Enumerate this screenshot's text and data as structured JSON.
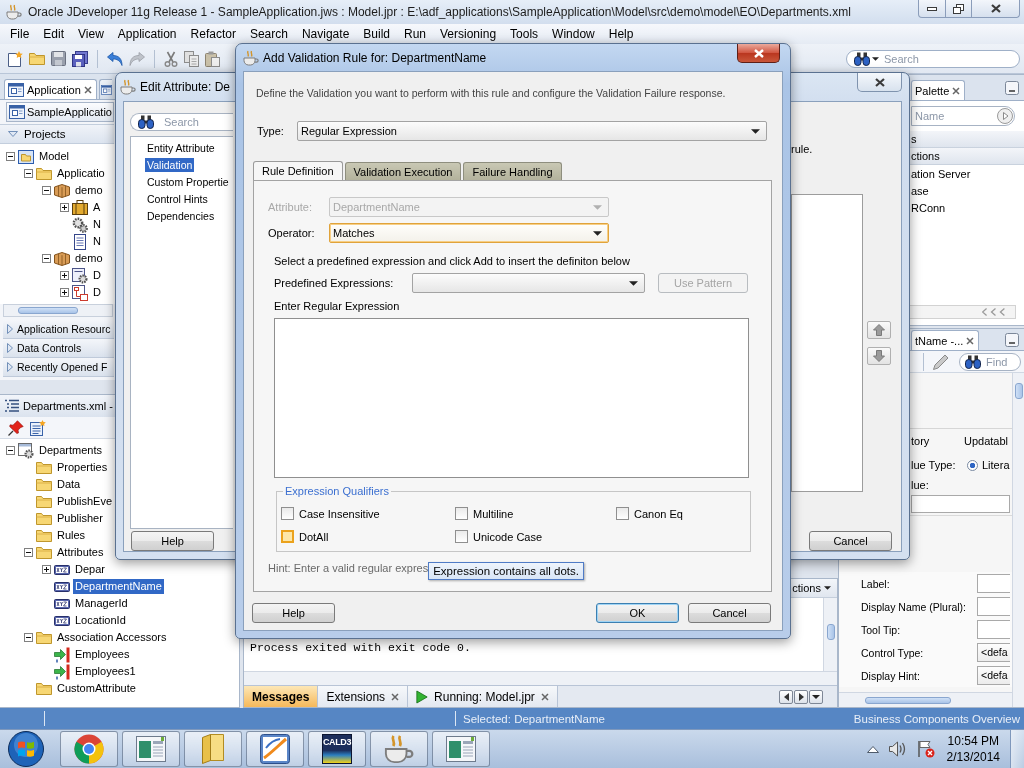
{
  "window": {
    "title": "Oracle JDeveloper 11g Release 1 - SampleApplication.jws : Model.jpr : E:\\adf_applications\\SampleApplication\\Model\\src\\demo\\model\\EO\\Departments.xml",
    "menu": [
      "File",
      "Edit",
      "View",
      "Application",
      "Refactor",
      "Search",
      "Navigate",
      "Build",
      "Run",
      "Versioning",
      "Tools",
      "Window",
      "Help"
    ],
    "search": {
      "placeholder": "Search"
    }
  },
  "navigator": {
    "tab": {
      "label": "Application",
      "selected": true
    },
    "project": "SampleApplicatio",
    "section": {
      "label": "Projects",
      "expanded": true
    },
    "tree": [
      {
        "label": "Model",
        "kind": "project",
        "expanded": true,
        "children": [
          {
            "label": "Applicatio",
            "kind": "folder",
            "expanded": true,
            "children": [
              {
                "label": "demo",
                "kind": "package",
                "expanded": true,
                "children": [
                  {
                    "label": "A",
                    "kind": "briefcase",
                    "expanded": false
                  },
                  {
                    "label": "N",
                    "kind": "gears"
                  },
                  {
                    "label": "N",
                    "kind": "document"
                  }
                ]
              },
              {
                "label": "demo",
                "kind": "package",
                "expanded": true,
                "children": [
                  {
                    "label": "D",
                    "kind": "gear-document",
                    "expanded": false
                  },
                  {
                    "label": "D",
                    "kind": "diagram",
                    "expanded": false
                  }
                ]
              }
            ]
          }
        ]
      }
    ],
    "accordions": [
      {
        "label": "Application Resourc",
        "expanded": false
      },
      {
        "label": "Data Controls",
        "expanded": false
      },
      {
        "label": "Recently Opened F",
        "expanded": false
      }
    ]
  },
  "structure": {
    "title": "Departments.xml -",
    "tree": [
      {
        "label": "Departments",
        "kind": "entity",
        "expanded": true,
        "selected": false,
        "children": [
          {
            "label": "Properties",
            "kind": "folder",
            "selected": false
          },
          {
            "label": "Data",
            "kind": "folder",
            "selected": false
          },
          {
            "label": "PublishEve",
            "kind": "folder",
            "selected": false
          },
          {
            "label": "Publisher",
            "kind": "folder",
            "selected": false
          },
          {
            "label": "Rules",
            "kind": "folder",
            "selected": false
          },
          {
            "label": "Attributes",
            "kind": "folder",
            "expanded": true,
            "selected": false,
            "children": [
              {
                "label": "Depar",
                "kind": "attribute",
                "expanded": false,
                "selected": false
              },
              {
                "label": "DepartmentName",
                "kind": "attribute",
                "selected": true
              },
              {
                "label": "ManagerId",
                "kind": "attribute",
                "selected": false
              },
              {
                "label": "LocationId",
                "kind": "attribute",
                "selected": false
              }
            ]
          },
          {
            "label": "Association Accessors",
            "kind": "folder",
            "expanded": true,
            "selected": false,
            "children": [
              {
                "label": "Employees",
                "kind": "association",
                "selected": false
              },
              {
                "label": "Employees1",
                "kind": "association",
                "selected": false
              }
            ]
          },
          {
            "label": "CustomAttribute",
            "kind": "folder",
            "selected": false
          }
        ]
      }
    ]
  },
  "edit_dialog": {
    "title": "Edit Attribute: De",
    "search": {
      "placeholder": "Search"
    },
    "nav": [
      {
        "label": "Entity Attribute",
        "selected": false
      },
      {
        "label": "Validation",
        "selected": true
      },
      {
        "label": "Custom Propertie",
        "selected": false
      },
      {
        "label": "Control Hints",
        "selected": false
      },
      {
        "label": "Dependencies",
        "selected": false
      }
    ],
    "note": "rule.",
    "buttons": [
      {
        "label": "Help"
      },
      {
        "label": "Cancel"
      }
    ]
  },
  "validation_dialog": {
    "title": "Add Validation Rule for: DepartmentName",
    "description": "Define the Validation you want to perform with this rule and configure the Validation Failure response.",
    "type": {
      "label": "Type:",
      "value": "Regular Expression"
    },
    "tabs": [
      {
        "label": "Rule Definition",
        "selected": true
      },
      {
        "label": "Validation Execution",
        "selected": false
      },
      {
        "label": "Failure Handling",
        "selected": false
      }
    ],
    "attribute": {
      "label": "Attribute:",
      "value": "DepartmentName",
      "disabled": true
    },
    "operator": {
      "label": "Operator:",
      "value": "Matches",
      "focused": true
    },
    "instruction": "Select a predefined expression and click Add to insert the definiton below",
    "predefined": {
      "label": "Predefined Expressions:",
      "button": "Use Pattern",
      "button_disabled": true
    },
    "expression": {
      "label": "Enter Regular Expression"
    },
    "qualifiers": {
      "legend": "Expression Qualifiers",
      "options": [
        {
          "label": "Case Insensitive",
          "checked": false,
          "focused": false
        },
        {
          "label": "Multiline",
          "checked": false,
          "focused": false
        },
        {
          "label": "Canon Eq",
          "checked": false,
          "focused": false
        },
        {
          "label": "DotAll",
          "checked": false,
          "focused": true
        },
        {
          "label": "Unicode Case",
          "checked": false,
          "focused": false
        }
      ]
    },
    "hint": "Hint: Enter a valid regular expres",
    "tooltip": "Expression contains all dots.",
    "buttons": [
      {
        "label": "Help",
        "default": false
      },
      {
        "label": "OK",
        "default": true
      },
      {
        "label": "Cancel",
        "default": false
      }
    ]
  },
  "palette": {
    "tab": {
      "label": "Palette",
      "selected": true
    },
    "search": {
      "placeholder": "Name"
    },
    "items": [
      {
        "label": "s",
        "kind": "header"
      },
      {
        "label": "ctions",
        "kind": "header"
      },
      {
        "label": "ation Server",
        "kind": "item"
      },
      {
        "label": "ase",
        "kind": "item"
      },
      {
        "label": "RConn",
        "kind": "item"
      }
    ]
  },
  "inspector": {
    "tab": {
      "label": "tName -...",
      "selected": true
    },
    "search": {
      "placeholder": "Find"
    },
    "rows": [
      {
        "kind": "pair",
        "label": "tory",
        "value": "Updatabl"
      },
      {
        "kind": "radio",
        "label": "lue Type:",
        "option": "Litera",
        "checked": true
      },
      {
        "kind": "label",
        "label": "lue:"
      },
      {
        "kind": "field"
      }
    ],
    "properties": [
      {
        "label": "Label:",
        "kind": "text"
      },
      {
        "label": "Display Name (Plural):",
        "kind": "text"
      },
      {
        "label": "Tool Tip:",
        "kind": "text"
      },
      {
        "label": "Control Type:",
        "kind": "select",
        "value": "<defa"
      },
      {
        "label": "Display Hint:",
        "kind": "select",
        "value": "<defa"
      }
    ]
  },
  "log": {
    "actions_menu": "ctions",
    "lines": [
      "Process exited with exit code 0."
    ],
    "tabs": [
      {
        "label": "Messages",
        "kind": "plain",
        "selected": true,
        "closable": false
      },
      {
        "label": "Extensions",
        "kind": "plain",
        "selected": false,
        "closable": true
      },
      {
        "label": "Running: Model.jpr",
        "kind": "run",
        "selected": false,
        "closable": true
      }
    ]
  },
  "status_bar": {
    "selection": "Selected: DepartmentName",
    "view": "Business Components Overview"
  },
  "taskbar": {
    "apps": [
      {
        "kind": "browser"
      },
      {
        "kind": "window"
      },
      {
        "kind": "folder"
      },
      {
        "kind": "chart"
      },
      {
        "kind": "dictionary",
        "label": "CALD3"
      },
      {
        "kind": "cup"
      },
      {
        "kind": "window"
      }
    ],
    "time": "10:54 PM",
    "date": "2/13/2014"
  }
}
